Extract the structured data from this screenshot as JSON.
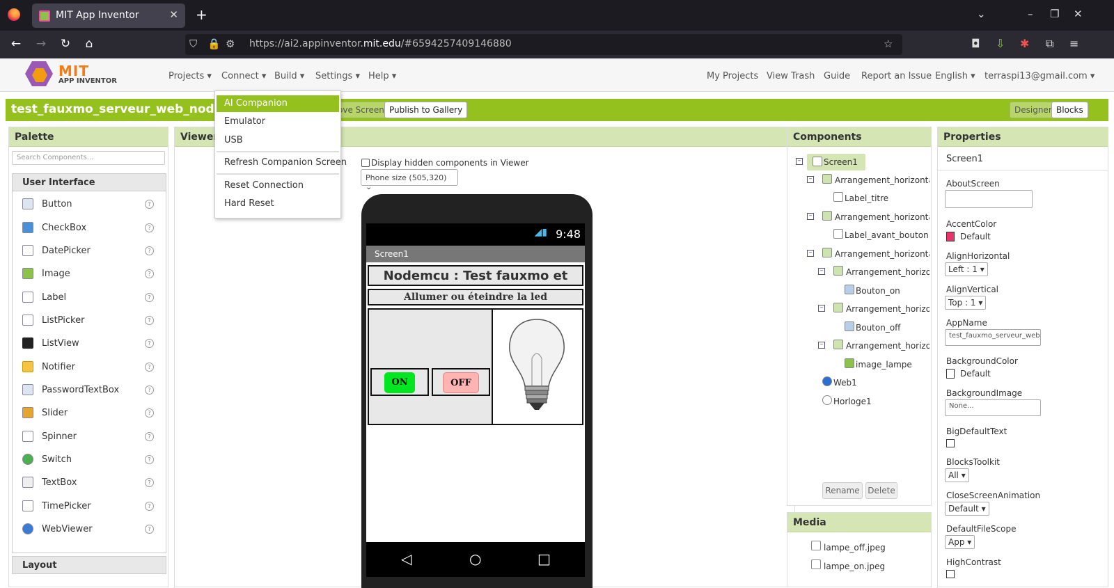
{
  "browser": {
    "tab_title": "MIT App Inventor",
    "url_prefix": "https://ai2.appinventor.",
    "url_domain": "mit.edu",
    "url_suffix": "/#6594257409146880"
  },
  "header": {
    "logo_text": "MIT",
    "logo_sub": "APP INVENTOR",
    "menus": [
      "Projects ▾",
      "Connect ▾",
      "Build ▾",
      "Settings ▾",
      "Help ▾"
    ],
    "right_links": [
      "My Projects",
      "View Trash",
      "Guide",
      "Report an Issue",
      "English ▾",
      "terraspi13@gmail.com ▾"
    ]
  },
  "project": {
    "name": "test_fauxmo_serveur_web_nodemcu",
    "remove_screen": "ove Screen",
    "publish": "Publish to Gallery",
    "designer": "Designer",
    "blocks": "Blocks"
  },
  "connect_menu": {
    "items": [
      "AI Companion",
      "Emulator",
      "USB",
      "Refresh Companion Screen",
      "Reset Connection",
      "Hard Reset"
    ],
    "selected": "AI Companion"
  },
  "palette": {
    "title": "Palette",
    "search_placeholder": "Search Components...",
    "section": "User Interface",
    "items": [
      "Button",
      "CheckBox",
      "DatePicker",
      "Image",
      "Label",
      "ListPicker",
      "ListView",
      "Notifier",
      "PasswordTextBox",
      "Slider",
      "Spinner",
      "Switch",
      "TextBox",
      "TimePicker",
      "WebViewer"
    ],
    "next_section": "Layout"
  },
  "viewer": {
    "title": "Viewer",
    "hidden_label": "Display hidden components in Viewer",
    "phone_size": "Phone size (505,320)",
    "time": "9:48",
    "screen_title": "Screen1",
    "app_title": "Nodemcu : Test fauxmo et",
    "app_subtitle": "Allumer ou éteindre la led",
    "btn_on": "ON",
    "btn_off": "OFF"
  },
  "components": {
    "title": "Components",
    "tree": [
      "Screen1",
      "Arrangement_horizontal_t",
      "Label_titre",
      "Arrangement_horizontal_s",
      "Label_avant_bouton",
      "Arrangement_horizontal_e",
      "Arrangement_horizont",
      "Bouton_on",
      "Arrangement_horizont",
      "Bouton_off",
      "Arrangement_horizont",
      "image_lampe",
      "Web1",
      "Horloge1"
    ],
    "rename": "Rename",
    "delete": "Delete"
  },
  "media": {
    "title": "Media",
    "files": [
      "lampe_off.jpeg",
      "lampe_on.jpeg"
    ]
  },
  "properties": {
    "title": "Properties",
    "component": "Screen1",
    "about_screen": "AboutScreen",
    "accent_color": "AccentColor",
    "accent_value": "Default",
    "accent_hex": "#e8336b",
    "align_h": "AlignHorizontal",
    "align_h_value": "Left : 1 ▾",
    "align_v": "AlignVertical",
    "align_v_value": "Top : 1 ▾",
    "app_name": "AppName",
    "app_name_value": "test_fauxmo_serveur_web_r",
    "bg_color": "BackgroundColor",
    "bg_color_value": "Default",
    "bg_image": "BackgroundImage",
    "bg_image_value": "None...",
    "big_default_text": "BigDefaultText",
    "blocks_toolkit": "BlocksToolkit",
    "blocks_toolkit_value": "All ▾",
    "close_anim": "CloseScreenAnimation",
    "close_anim_value": "Default ▾",
    "file_scope": "DefaultFileScope",
    "file_scope_value": "App ▾",
    "high_contrast": "HighContrast"
  },
  "colors": {
    "brand_green": "#95c11f",
    "panel_head": "#d5e5b4"
  }
}
